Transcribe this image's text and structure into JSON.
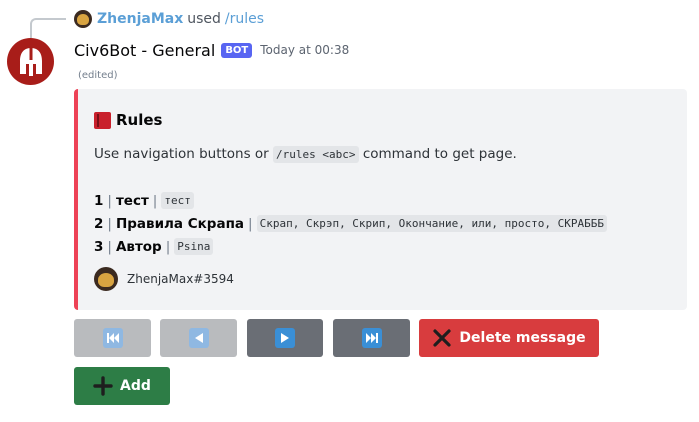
{
  "reply": {
    "username": "ZhenjaMax",
    "used_text": "used",
    "command": "/rules"
  },
  "message": {
    "author": "Civ6Bot - General",
    "badge": "BOT",
    "timestamp": "Today at 00:38",
    "edited": "(edited)"
  },
  "embed": {
    "accent_color": "#ed4256",
    "title": "Rules",
    "title_icon": "red-book-icon",
    "description": {
      "before": "Use navigation buttons or",
      "code": "/rules <abc>",
      "after": "command to get page."
    },
    "rules": [
      {
        "num": "1",
        "name": "тест",
        "aliases": "тест"
      },
      {
        "num": "2",
        "name": "Правила Скрапа",
        "aliases": "Скрап, Скрэп, Скрип, Окончание, или, просто, СКРАБББ"
      },
      {
        "num": "3",
        "name": "Автор",
        "aliases": "Psina"
      }
    ],
    "footer": "ZhenjaMax#3594"
  },
  "buttons": {
    "first_icon": "first-page-icon",
    "prev_icon": "previous-page-icon",
    "next_icon": "next-page-icon",
    "last_icon": "last-page-icon",
    "delete": "Delete message",
    "add": "Add"
  }
}
